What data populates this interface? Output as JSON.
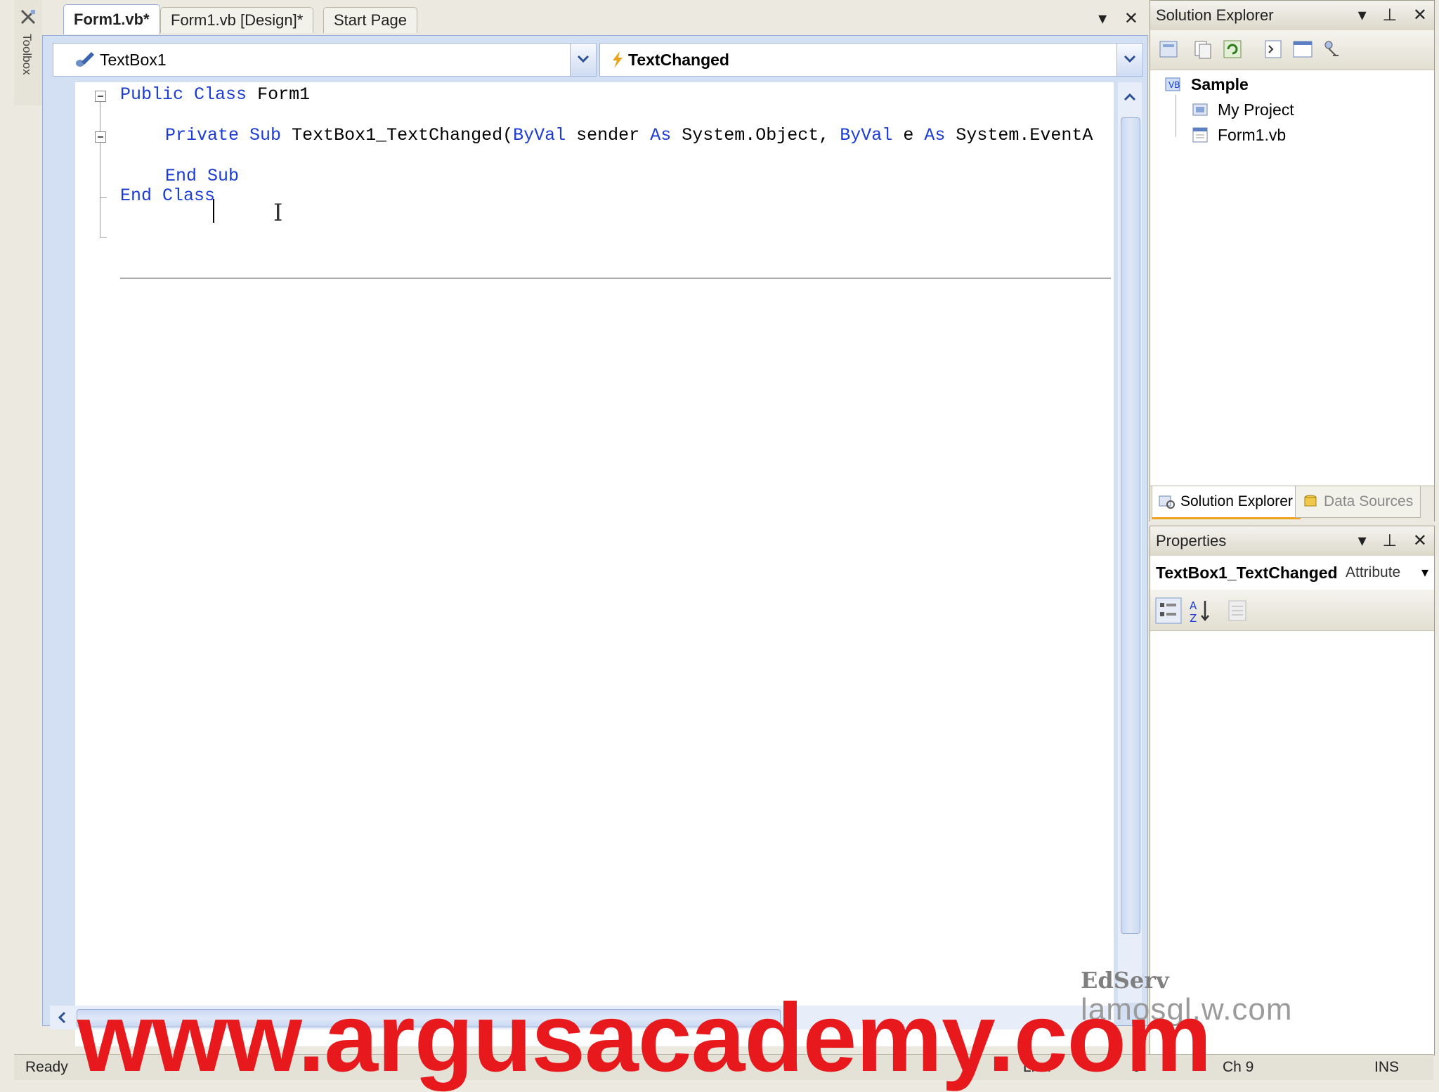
{
  "toolbox": {
    "label": "Toolbox"
  },
  "tabs": [
    {
      "label": "Form1.vb*",
      "active": true
    },
    {
      "label": "Form1.vb [Design]*",
      "active": false
    },
    {
      "label": "Start Page",
      "active": false
    }
  ],
  "tab_actions": {
    "dropdown": "▾",
    "close": "✕"
  },
  "editor": {
    "object_combo": "TextBox1",
    "event_combo": "TextChanged",
    "code": {
      "line1": {
        "kw1": "Public",
        "kw2": "Class",
        "name": "Form1"
      },
      "line3": {
        "kw_private": "Private",
        "kw_sub": "Sub",
        "method": "TextBox1_TextChanged(",
        "kw_byval1": "ByVal",
        "p1": "sender",
        "kw_as1": "As",
        "t1": "System.Object,",
        "kw_byval2": "ByVal",
        "p2": "e",
        "kw_as2": "As",
        "t2": "System.EventA"
      },
      "line5": {
        "kw_end": "End",
        "kw_sub": "Sub"
      },
      "line6": {
        "kw_end": "End",
        "kw_class": "Class"
      }
    }
  },
  "solution_explorer": {
    "title": "Solution Explorer",
    "tree": {
      "root": "Sample",
      "children": [
        "My Project",
        "Form1.vb"
      ]
    },
    "bottom_tabs": [
      "Solution Explorer",
      "Data Sources"
    ]
  },
  "properties": {
    "title": "Properties",
    "selected_object": "TextBox1_TextChanged",
    "selected_type": "Attribute"
  },
  "status_bar": {
    "ready": "Ready",
    "ln": "Ln 4",
    "col": "9",
    "ch": "Ch 9",
    "ins": "INS"
  },
  "watermarks": {
    "edserv": "EdServ",
    "lynda": "lamosgl.w.com",
    "site": "www.argusacademy.com"
  },
  "colors": {
    "keyword": "#1b3cd6",
    "watermark": "#e8191c",
    "accent_tab": "#f0a31d"
  }
}
